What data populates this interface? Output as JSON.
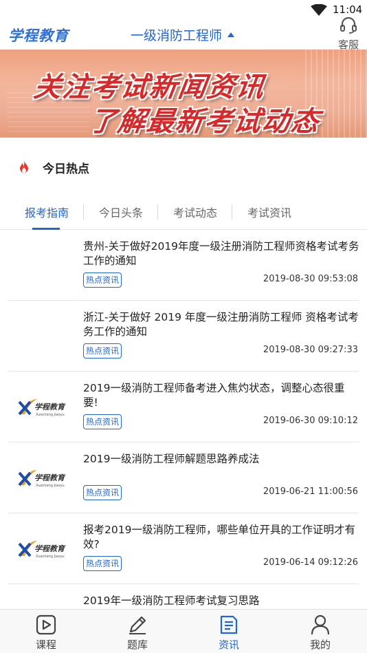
{
  "status": {
    "time": "11:04"
  },
  "header": {
    "brand": "学程教育",
    "exam_select": "一级消防工程师",
    "service_label": "客服"
  },
  "banner": {
    "line1": "关注考试新闻资讯",
    "line2": "了解最新考试动态"
  },
  "hot": {
    "title": "今日热点"
  },
  "tabs": [
    {
      "label": "报考指南",
      "active": true
    },
    {
      "label": "今日头条",
      "active": false
    },
    {
      "label": "考试动态",
      "active": false
    },
    {
      "label": "考试资讯",
      "active": false
    }
  ],
  "articles": [
    {
      "title": "贵州-关于做好2019年度一级注册消防工程师资格考试考务工作的通知",
      "tag": "热点资讯",
      "date": "2019-08-30 09:53:08",
      "has_logo": false
    },
    {
      "title": "浙江-关于做好 2019 年度一级注册消防工程师 资格考试考务工作的通知",
      "tag": "热点资讯",
      "date": "2019-08-30 09:27:33",
      "has_logo": false
    },
    {
      "title": "2019一级消防工程师备考进入焦灼状态，调整心态很重要!",
      "tag": "热点资讯",
      "date": "2019-06-30 09:10:12",
      "has_logo": true
    },
    {
      "title": "2019一级消防工程师解题思路养成法",
      "tag": "热点资讯",
      "date": "2019-06-21 11:00:56",
      "has_logo": true
    },
    {
      "title": "报考2019一级消防工程师，哪些单位开具的工作证明才有效?",
      "tag": "热点资讯",
      "date": "2019-06-14 09:12:26",
      "has_logo": true
    },
    {
      "title": "2019年一级消防工程师考试复习思路",
      "tag": "",
      "date": "",
      "has_logo": true
    }
  ],
  "logo_text": {
    "main": "学程教育",
    "sub": "Xuecheng Jiaoyu"
  },
  "bottom_nav": [
    {
      "label": "课程",
      "icon": "play-icon",
      "active": false
    },
    {
      "label": "题库",
      "icon": "pencil-icon",
      "active": false
    },
    {
      "label": "资讯",
      "icon": "document-icon",
      "active": true
    },
    {
      "label": "我的",
      "icon": "person-icon",
      "active": false
    }
  ],
  "colors": {
    "accent": "#1f66d8",
    "banner_text": "#d62a2a",
    "fire": "#e8372c"
  }
}
